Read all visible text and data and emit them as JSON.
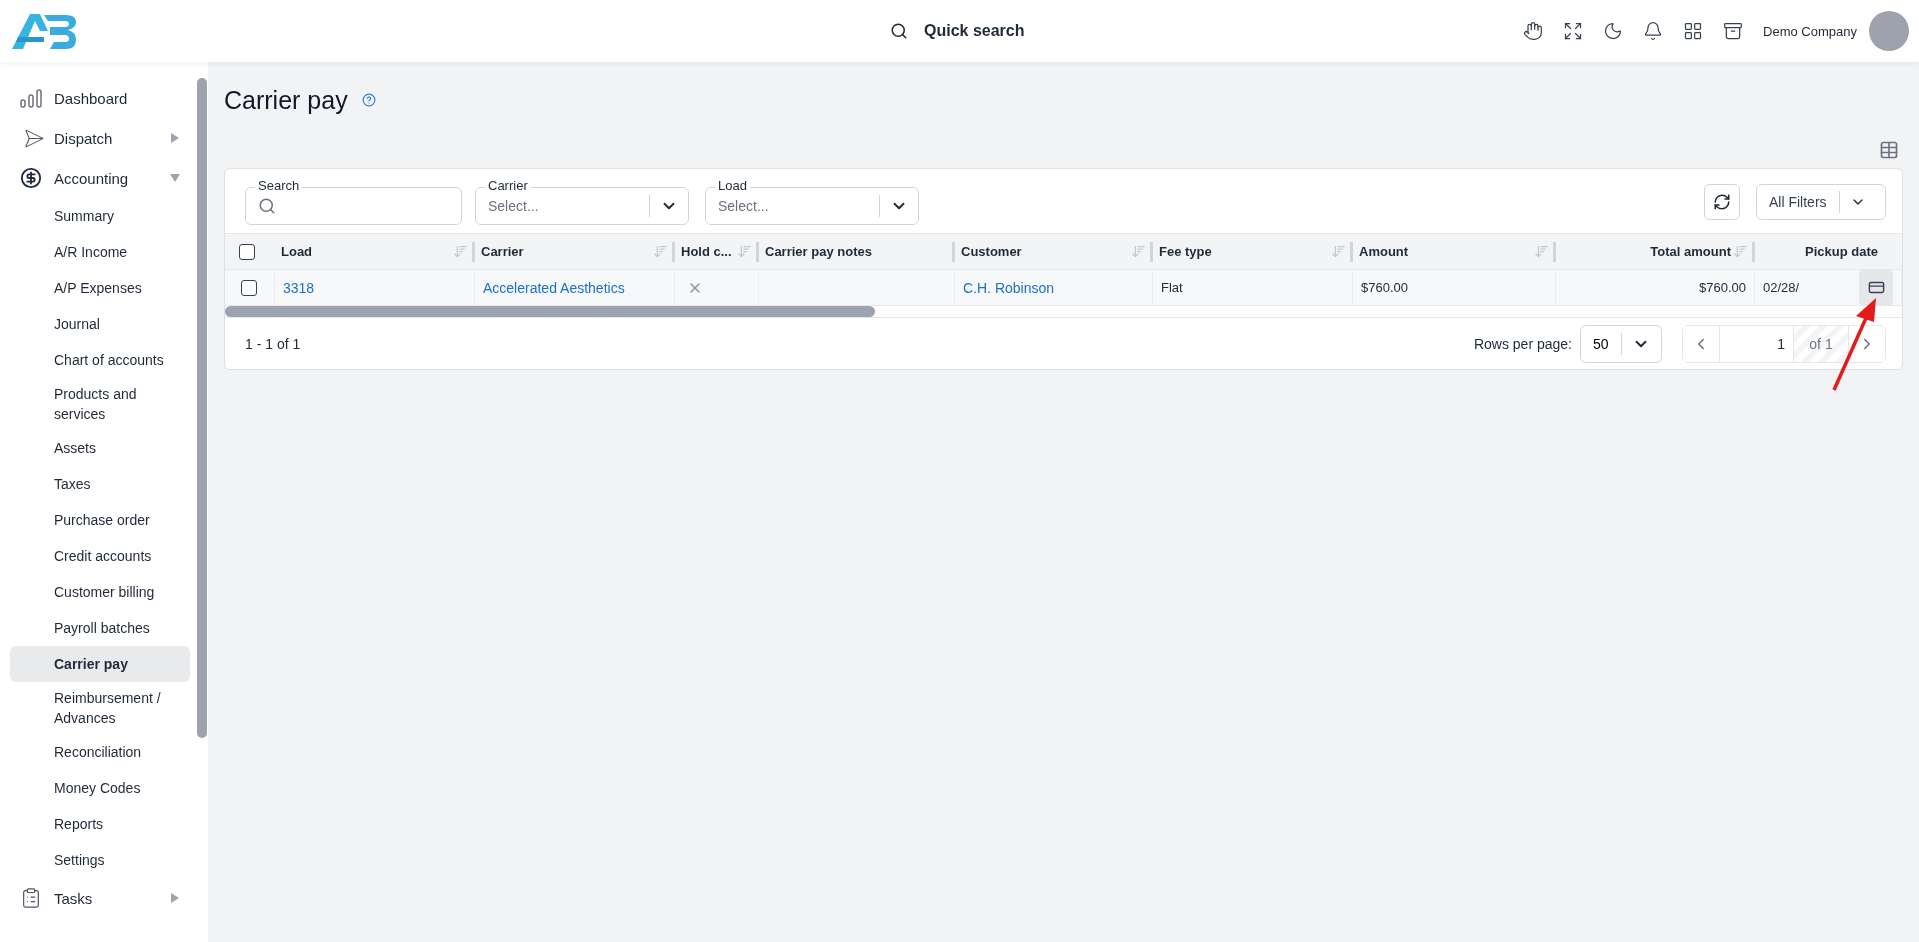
{
  "header": {
    "search_label": "Quick search",
    "company": "Demo Company"
  },
  "sidebar": {
    "items": [
      {
        "label": "Dashboard",
        "kind": "dashboard",
        "expandable": false,
        "expanded": false,
        "selected": false
      },
      {
        "label": "Dispatch",
        "kind": "dispatch",
        "expandable": true,
        "expanded": false,
        "selected": false
      },
      {
        "label": "Accounting",
        "kind": "accounting",
        "expandable": true,
        "expanded": true,
        "selected": false,
        "children": [
          {
            "label": "Summary",
            "selected": false
          },
          {
            "label": "A/R Income",
            "selected": false
          },
          {
            "label": "A/P Expenses",
            "selected": false
          },
          {
            "label": "Journal",
            "selected": false
          },
          {
            "label": "Chart of accounts",
            "selected": false
          },
          {
            "label": "Products and services",
            "selected": false
          },
          {
            "label": "Assets",
            "selected": false
          },
          {
            "label": "Taxes",
            "selected": false
          },
          {
            "label": "Purchase order",
            "selected": false
          },
          {
            "label": "Credit accounts",
            "selected": false
          },
          {
            "label": "Customer billing",
            "selected": false
          },
          {
            "label": "Payroll batches",
            "selected": false
          },
          {
            "label": "Carrier pay",
            "selected": true
          },
          {
            "label": "Reimbursement / Advances",
            "selected": false
          },
          {
            "label": "Reconciliation",
            "selected": false
          },
          {
            "label": "Money Codes",
            "selected": false
          },
          {
            "label": "Reports",
            "selected": false
          },
          {
            "label": "Settings",
            "selected": false
          }
        ]
      },
      {
        "label": "Tasks",
        "kind": "tasks",
        "expandable": true,
        "expanded": false,
        "selected": false
      }
    ]
  },
  "page": {
    "title": "Carrier pay"
  },
  "filters": [
    {
      "kind": "search",
      "label": "Search"
    },
    {
      "kind": "select",
      "label": "Carrier",
      "placeholder": "Select..."
    },
    {
      "kind": "select",
      "label": "Load",
      "placeholder": "Select..."
    }
  ],
  "all_filters": "All Filters",
  "table": {
    "header_checked": false,
    "columns": [
      {
        "label": "Load",
        "sortable": true
      },
      {
        "label": "Carrier",
        "sortable": true
      },
      {
        "label": "Hold c...",
        "sortable": true
      },
      {
        "label": "Carrier pay notes",
        "sortable": false
      },
      {
        "label": "Customer",
        "sortable": true
      },
      {
        "label": "Fee type",
        "sortable": true
      },
      {
        "label": "Amount",
        "sortable": true
      },
      {
        "label": "Total amount",
        "sortable": true
      },
      {
        "label": "Pickup date",
        "sortable": false
      }
    ],
    "rows": [
      {
        "checked": false,
        "cells": [
          {
            "kind": "link",
            "text": "3318"
          },
          {
            "kind": "link",
            "text": "Accelerated Aesthetics"
          },
          {
            "kind": "hold",
            "on": false
          },
          {
            "kind": "empty"
          },
          {
            "kind": "link",
            "text": "C.H. Robinson"
          },
          {
            "kind": "text",
            "text": "Flat"
          },
          {
            "kind": "text",
            "text": "$760.00"
          },
          {
            "kind": "text",
            "text": "$760.00"
          },
          {
            "kind": "text",
            "text": "02/28/"
          }
        ]
      }
    ]
  },
  "footer": {
    "range": "1 - 1 of 1",
    "rows_per_page_label": "Rows per page:",
    "rows_per_page": "50",
    "page": "1",
    "page_total": "of 1"
  }
}
